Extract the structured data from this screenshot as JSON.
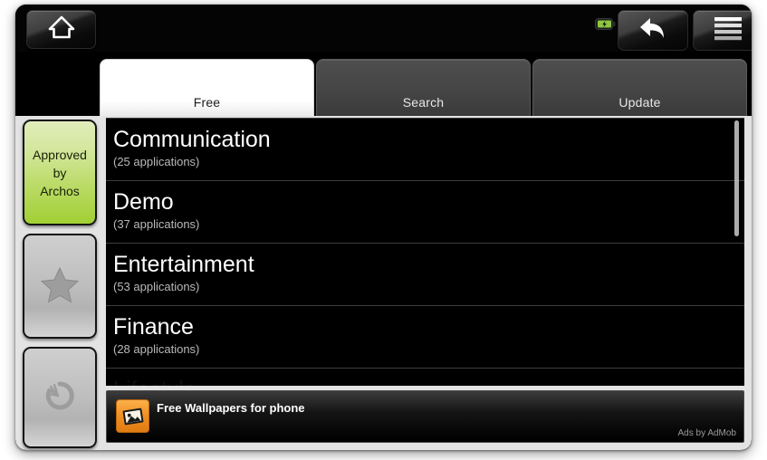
{
  "statusbar": {
    "home_button_label": "Home",
    "home_icon": "home-icon",
    "battery_icon": "battery-charging-icon",
    "battery_status": "charging",
    "back_button_label": "Back",
    "back_icon": "back-arrow-icon",
    "menu_button_label": "Menu",
    "menu_icon": "hamburger-menu-icon"
  },
  "tabs": [
    {
      "label": "Free",
      "active": true
    },
    {
      "label": "Search",
      "active": false
    },
    {
      "label": "Update",
      "active": false
    }
  ],
  "sidebar": {
    "items": [
      {
        "label": "Approved by Archos",
        "line1": "Approved",
        "line2": "by",
        "line3": "Archos",
        "icon": "approved-badge",
        "active": true
      },
      {
        "label": "Favorites",
        "icon": "star-icon",
        "active": false
      },
      {
        "label": "Recently Used",
        "icon": "history-dial-icon",
        "active": false
      }
    ]
  },
  "categories": [
    {
      "name": "Communication",
      "count": "(25 applications)"
    },
    {
      "name": "Demo",
      "count": "(37 applications)"
    },
    {
      "name": "Entertainment",
      "count": "(53 applications)"
    },
    {
      "name": "Finance",
      "count": "(28 applications)"
    },
    {
      "name": "Lifestyle",
      "count": ""
    }
  ],
  "ad": {
    "title": "Free Wallpapers for phone",
    "attribution": "Ads by AdMob",
    "icon": "wallpaper-image-icon",
    "accent_color": "#f08e22"
  },
  "colors": {
    "screen_background": "#000000",
    "panel_background": "#e3e3e3",
    "active_tab": "#ffffff",
    "inactive_tab": "#454545",
    "approved_green": "#a2cf33",
    "list_text": "#ffffff",
    "list_subtext": "#b9b9b9"
  }
}
